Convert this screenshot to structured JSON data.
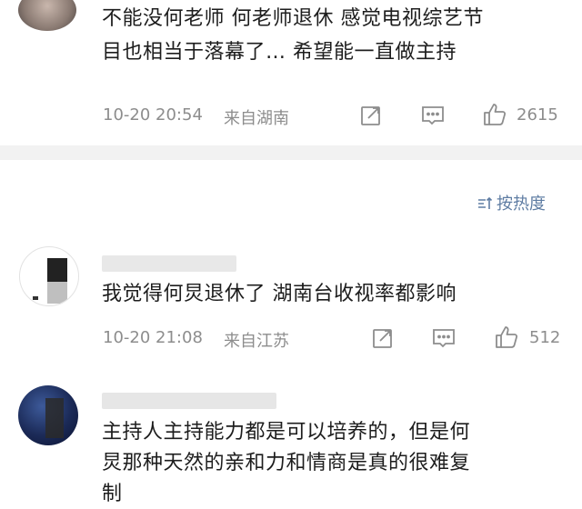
{
  "comments": [
    {
      "text_line1": "不能没何老师 何老师退休 感觉电视综艺节",
      "text_line2": "目也相当于落幕了… 希望能一直做主持",
      "time": "10-20 20:54",
      "location": "来自湖南",
      "likes": "2615"
    },
    {
      "text_line1": "我觉得何炅退休了 湖南台收视率都影响",
      "time": "10-20 21:08",
      "location": "来自江苏",
      "likes": "512"
    },
    {
      "text_line1": "主持人主持能力都是可以培养的，但是何",
      "text_line2": "炅那种天然的亲和力和情商是真的很难复",
      "text_line3": "制"
    }
  ],
  "sort": {
    "label": "按热度"
  },
  "colors": {
    "meta_gray": "#8d8d8d",
    "link_blue": "#5f7da3",
    "separator": "#f2f2f2"
  }
}
